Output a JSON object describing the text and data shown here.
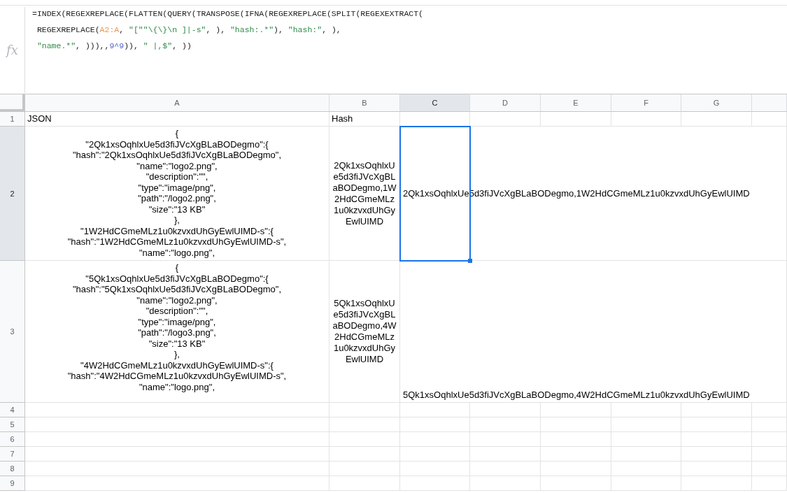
{
  "formula_bar": {
    "label": "fx",
    "lines": [
      [
        {
          "kind": "plain",
          "text": "=INDEX(REGEXREPLACE(FLATTEN(QUERY(TRANSPOSE(IFNA(REGEXREPLACE(SPLIT(REGEXEXTRACT("
        }
      ],
      [
        {
          "kind": "plain",
          "text": "REGEXREPLACE("
        },
        {
          "kind": "range",
          "text": "A2:A"
        },
        {
          "kind": "plain",
          "text": ", "
        },
        {
          "kind": "string",
          "text": "\"[\"\"\\{\\}\\n ]|-s\""
        },
        {
          "kind": "plain",
          "text": ", ), "
        },
        {
          "kind": "string",
          "text": "\"hash:.*\""
        },
        {
          "kind": "plain",
          "text": "), "
        },
        {
          "kind": "string",
          "text": "\"hash:\""
        },
        {
          "kind": "plain",
          "text": ", ),"
        }
      ],
      [
        {
          "kind": "string",
          "text": "\"name.*\""
        },
        {
          "kind": "plain",
          "text": ", ))),,"
        },
        {
          "kind": "number",
          "text": "9^9"
        },
        {
          "kind": "plain",
          "text": ")), "
        },
        {
          "kind": "string",
          "text": "\" |,$\""
        },
        {
          "kind": "plain",
          "text": ", ))"
        }
      ]
    ]
  },
  "columns": [
    {
      "label": "A",
      "selected": false
    },
    {
      "label": "B",
      "selected": false
    },
    {
      "label": "C",
      "selected": true
    },
    {
      "label": "D",
      "selected": false
    },
    {
      "label": "E",
      "selected": false
    },
    {
      "label": "F",
      "selected": false
    },
    {
      "label": "G",
      "selected": false
    }
  ],
  "rows": [
    {
      "label": "1",
      "selected": false,
      "cells": [
        {
          "kind": "plain",
          "text": "JSON"
        },
        {
          "kind": "plain",
          "text": "Hash"
        }
      ]
    },
    {
      "label": "2",
      "selected": true,
      "cells": [
        {
          "kind": "json",
          "text": "{\n\"2Qk1xsOqhlxUe5d3fiJVcXgBLaBODegmo\":{\n\"hash\":\"2Qk1xsOqhlxUe5d3fiJVcXgBLaBODegmo\",\n\"name\":\"logo2.png\",\n\"description\":\"\",\n\"type\":\"image/png\",\n\"path\":\"/logo2.png\",\n\"size\":\"13 KB\"\n},\n\"1W2HdCGmeMLz1u0kzvxdUhGyEwlUIMD-s\":{\n\"hash\":\"1W2HdCGmeMLz1u0kzvxdUhGyEwlUIMD-s\",\n\"name\":\"logo.png\","
        },
        {
          "kind": "wrapped",
          "text": "2Qk1xsOqhlxUe5d3fiJVcXgBLaBODegmo,1W2HdCGmeMLz1u0kzvxdUhGyEwlUIMD"
        },
        {
          "kind": "overflow",
          "text": "2Qk1xsOqhlxUe5d3fiJVcXgBLaBODegmo,1W2HdCGmeMLz1u0kzvxdUhGyEwlUIMD"
        }
      ]
    },
    {
      "label": "3",
      "selected": false,
      "cells": [
        {
          "kind": "json",
          "text": "{\n\"5Qk1xsOqhlxUe5d3fiJVcXgBLaBODegmo\":{\n\"hash\":\"5Qk1xsOqhlxUe5d3fiJVcXgBLaBODegmo\",\n\"name\":\"logo2.png\",\n\"description\":\"\",\n\"type\":\"image/png\",\n\"path\":\"/logo3.png\",\n\"size\":\"13 KB\"\n},\n\"4W2HdCGmeMLz1u0kzvxdUhGyEwlUIMD-s\":{\n\"hash\":\"4W2HdCGmeMLz1u0kzvxdUhGyEwlUIMD-s\",\n\"name\":\"logo.png\","
        },
        {
          "kind": "wrapped",
          "text": "5Qk1xsOqhlxUe5d3fiJVcXgBLaBODegmo,4W2HdCGmeMLz1u0kzvxdUhGyEwlUIMD"
        },
        {
          "kind": "overflow",
          "text": "5Qk1xsOqhlxUe5d3fiJVcXgBLaBODegmo,4W2HdCGmeMLz1u0kzvxdUhGyEwlUIMD"
        }
      ]
    },
    {
      "label": "4",
      "selected": false
    },
    {
      "label": "5",
      "selected": false
    },
    {
      "label": "6",
      "selected": false
    },
    {
      "label": "7",
      "selected": false
    },
    {
      "label": "8",
      "selected": false
    },
    {
      "label": "9",
      "selected": false
    }
  ]
}
